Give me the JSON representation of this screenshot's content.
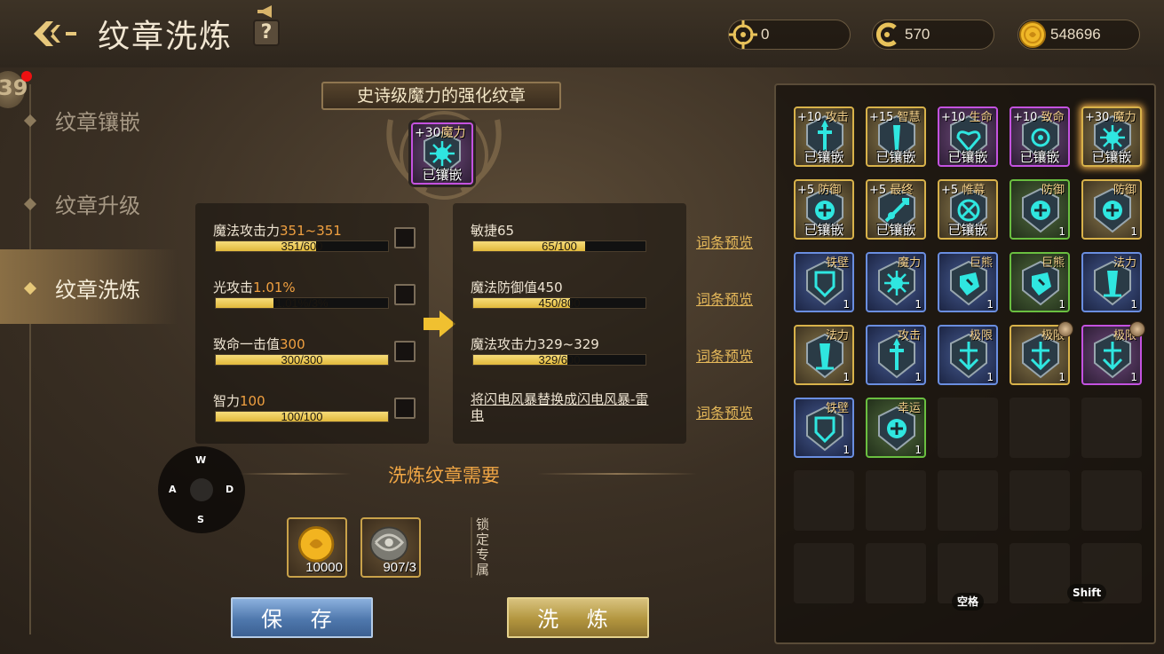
{
  "header": {
    "title": "纹章洗炼",
    "help_label": "?",
    "currencies": [
      {
        "icon": "target-coin-icon",
        "value": "0"
      },
      {
        "icon": "c-token-icon",
        "value": "570"
      },
      {
        "icon": "gold-coin-icon",
        "value": "548696"
      }
    ]
  },
  "sidebar": {
    "level_badge": "39",
    "items": [
      {
        "label": "纹章镶嵌",
        "active": false
      },
      {
        "label": "纹章升级",
        "active": false
      },
      {
        "label": "纹章洗炼",
        "active": true
      }
    ]
  },
  "emblem": {
    "banner": "史诗级魔力的强化纹章",
    "level": "+30",
    "type": "魔力",
    "state": "已镶嵌"
  },
  "current_stats": [
    {
      "name": "魔法攻击力",
      "value": "351~351",
      "bar_text": "351/600",
      "fill": 0.585
    },
    {
      "name": "光攻击",
      "value": "1.01%",
      "bar_text": "1.01%/3%",
      "fill": 0.337
    },
    {
      "name": "致命一击值",
      "value": "300",
      "bar_text": "300/300",
      "fill": 1.0
    },
    {
      "name": "智力",
      "value": "100",
      "bar_text": "100/100",
      "fill": 1.0
    }
  ],
  "new_stats": [
    {
      "name": "敏捷65",
      "bar_text": "65/100",
      "fill": 0.65
    },
    {
      "name": "魔法防御值450",
      "bar_text": "450/800",
      "fill": 0.5625
    },
    {
      "name": "魔法攻击力329~329",
      "bar_text": "329/600",
      "fill": 0.548
    },
    {
      "name": "将闪电风暴替换成闪电风暴-雷电"
    }
  ],
  "preview_label": "词条预览",
  "wasd": {
    "w": "W",
    "a": "A",
    "s": "S",
    "d": "D"
  },
  "requirements": {
    "title": "洗炼纹章需要",
    "items": [
      {
        "icon": "gold-coin-icon",
        "count": "10000"
      },
      {
        "icon": "refine-stone-icon",
        "count": "907/3"
      }
    ],
    "lock_label": "锁定专属"
  },
  "buttons": {
    "save": "保 存",
    "refine": "洗 炼"
  },
  "inventory": {
    "slots": [
      {
        "rarity": "gold",
        "plus": "+10",
        "type": "攻击",
        "label": "已镶嵌",
        "glyph": "attack"
      },
      {
        "rarity": "gold",
        "plus": "+15",
        "type": "智慧",
        "label": "已镶嵌",
        "glyph": "wisdom"
      },
      {
        "rarity": "purple",
        "plus": "+10",
        "type": "生命",
        "label": "已镶嵌",
        "glyph": "life"
      },
      {
        "rarity": "purple",
        "plus": "+10",
        "type": "致命",
        "label": "已镶嵌",
        "glyph": "crit"
      },
      {
        "rarity": "gold",
        "plus": "+30",
        "type": "魔力",
        "label": "已镶嵌",
        "glyph": "magic",
        "glow": true
      },
      {
        "rarity": "gold",
        "plus": "+5",
        "type": "防御",
        "label": "已镶嵌",
        "glyph": "defense"
      },
      {
        "rarity": "gold",
        "plus": "+5",
        "type": "最终",
        "label": "已镶嵌",
        "glyph": "final"
      },
      {
        "rarity": "gold",
        "plus": "+5",
        "type": "帷幕",
        "label": "已镶嵌",
        "glyph": "curtain"
      },
      {
        "rarity": "green",
        "type": "防御",
        "count": "1",
        "glyph": "defense"
      },
      {
        "rarity": "gold",
        "type": "防御",
        "count": "1",
        "glyph": "defense"
      },
      {
        "rarity": "blue",
        "type": "铁壁",
        "count": "1",
        "glyph": "wall"
      },
      {
        "rarity": "blue",
        "type": "魔力",
        "count": "1",
        "glyph": "magic"
      },
      {
        "rarity": "blue",
        "type": "巨熊",
        "count": "1",
        "glyph": "bear"
      },
      {
        "rarity": "green",
        "type": "巨熊",
        "count": "1",
        "glyph": "bear"
      },
      {
        "rarity": "blue",
        "type": "法力",
        "count": "1",
        "glyph": "mana"
      },
      {
        "rarity": "gold",
        "type": "法力",
        "count": "1",
        "glyph": "mana"
      },
      {
        "rarity": "blue",
        "type": "攻击",
        "count": "1",
        "glyph": "attack"
      },
      {
        "rarity": "blue",
        "type": "极限",
        "count": "1",
        "glyph": "limit"
      },
      {
        "rarity": "gold",
        "type": "极限",
        "count": "1",
        "glyph": "limit",
        "coin": true
      },
      {
        "rarity": "purple",
        "type": "极限",
        "count": "1",
        "glyph": "limit",
        "coin": true
      },
      {
        "rarity": "blue",
        "type": "铁壁",
        "count": "1",
        "glyph": "wall"
      },
      {
        "rarity": "green",
        "type": "幸运",
        "count": "1",
        "glyph": "luck"
      }
    ],
    "key_hints": [
      "空格",
      "Shift"
    ]
  },
  "colors": {
    "accent_gold": "#e6b95a",
    "highlight_orange": "#f0a040",
    "emblem_cyan": "#2fe6e0"
  }
}
